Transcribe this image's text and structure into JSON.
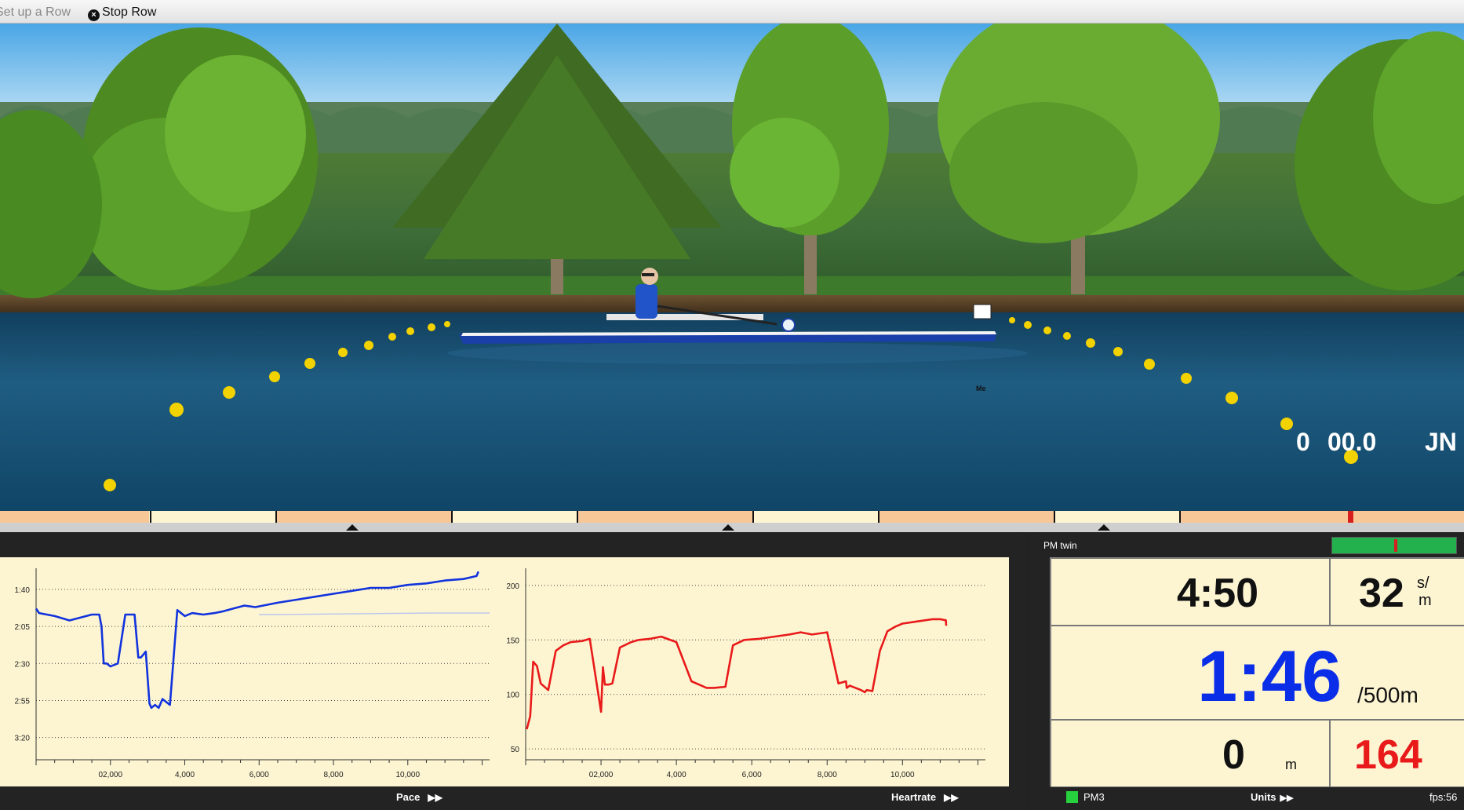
{
  "menu": {
    "setup_label": "Set up a Row",
    "stop_label": "Stop Row"
  },
  "scene": {
    "boat_tag": "Me",
    "overlay_distance": "0",
    "overlay_time": "00.0",
    "overlay_initials": "JN"
  },
  "charts": {
    "pace": {
      "footer_label": "Pace",
      "y_tick_labels": [
        "1:40",
        "2:05",
        "2:30",
        "2:55",
        "3:20"
      ],
      "x_tick_labels": [
        "02,000",
        "4,000",
        "6,000",
        "8,000",
        "10,000"
      ]
    },
    "heartrate": {
      "footer_label": "Heartrate",
      "y_tick_labels": [
        "200",
        "150",
        "100",
        "50"
      ],
      "x_tick_labels": [
        "02,000",
        "4,000",
        "6,000",
        "8,000",
        "10,000"
      ]
    }
  },
  "pm": {
    "title": "PM twin",
    "elapsed_time": "4:50",
    "stroke_rate": "32",
    "stroke_rate_unit_top": "s/",
    "stroke_rate_unit_bottom": "m",
    "pace": "1:46",
    "pace_unit": "/500m",
    "distance": "0",
    "distance_unit": "m",
    "heart_rate": "164",
    "monitor_label": "PM3",
    "units_label": "Units",
    "fps_label": "fps:56"
  },
  "colors": {
    "pace_line": "#1133dd",
    "heartrate_line": "#e81a1a",
    "panel_bg": "#fdf5d2",
    "pace_display": "#0a2ee8",
    "heart_rate_display": "#e81a1a",
    "strip_peach": "#f8c797"
  },
  "chart_data": [
    {
      "type": "line",
      "title": "",
      "xlabel": "",
      "ylabel": "",
      "y_inverted": true,
      "ylim": [
        90,
        215
      ],
      "xlim": [
        0,
        12200
      ],
      "grid": true,
      "series": [
        {
          "x": [
            0,
            80,
            500,
            900,
            1500,
            1700,
            1760,
            1820,
            1900,
            2000,
            2200,
            2400,
            2650,
            2750,
            2820,
            2950,
            3050,
            3100,
            3200,
            3300,
            3400,
            3600,
            3800,
            4000,
            4200,
            4500,
            4800,
            5000,
            5300,
            5600,
            5900,
            6100,
            6500,
            7000,
            7500,
            8000,
            8500,
            9000,
            9500,
            10000,
            10500,
            11000,
            11500,
            11850,
            11900
          ],
          "y": [
            113,
            116,
            118,
            121,
            117,
            117,
            125,
            150,
            150,
            152,
            150,
            117,
            117,
            146,
            146,
            142,
            177,
            180,
            178,
            180,
            174,
            178,
            114,
            118,
            116,
            117,
            116,
            115,
            113,
            111,
            112,
            111,
            109,
            107,
            105,
            103,
            101,
            99,
            99,
            97,
            96,
            94,
            93,
            91,
            88
          ]
        },
        {
          "x": [
            6000,
            6400,
            10600,
            12200
          ],
          "y": [
            117,
            117,
            116,
            116
          ]
        }
      ]
    },
    {
      "type": "line",
      "title": "",
      "xlabel": "",
      "ylabel": "",
      "ylim": [
        40,
        210
      ],
      "xlim": [
        0,
        12200
      ],
      "grid": true,
      "series": [
        {
          "x": [
            30,
            120,
            200,
            300,
            400,
            600,
            800,
            1000,
            1200,
            1500,
            1700,
            2000,
            2050,
            2100,
            2200,
            2300,
            2500,
            2800,
            3000,
            3300,
            3600,
            4000,
            4400,
            4800,
            5000,
            5300,
            5500,
            5800,
            6200,
            6600,
            7000,
            7300,
            7600,
            8000,
            8300,
            8500,
            8520,
            8600,
            8900,
            9000,
            9050,
            9200,
            9400,
            9600,
            9800,
            10000,
            10400,
            10800,
            11000,
            11150,
            11160
          ],
          "y": [
            68,
            80,
            130,
            126,
            110,
            104,
            140,
            145,
            148,
            149,
            151,
            84,
            125,
            109,
            109,
            110,
            143,
            148,
            150,
            151,
            153,
            148,
            112,
            106,
            106,
            107,
            145,
            150,
            151,
            153,
            155,
            157,
            155,
            157,
            110,
            112,
            106,
            108,
            104,
            102,
            104,
            103,
            140,
            158,
            162,
            165,
            167,
            169,
            169,
            168,
            163
          ]
        }
      ]
    }
  ]
}
